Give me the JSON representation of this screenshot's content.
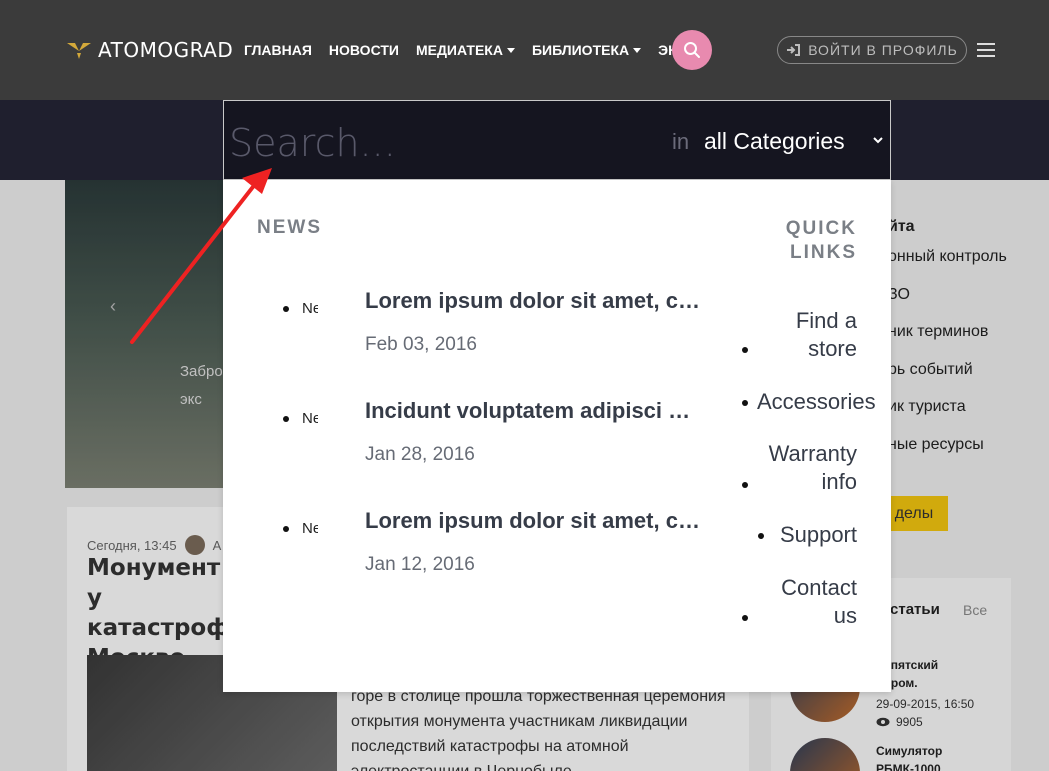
{
  "header": {
    "logo_text": "ATOMOGRAD",
    "nav": [
      {
        "label": "ГЛАВНАЯ",
        "has_caret": false
      },
      {
        "label": "НОВОСТИ",
        "has_caret": false
      },
      {
        "label": "МЕДИАТЕКА",
        "has_caret": true
      },
      {
        "label": "БИБЛИОТЕКА",
        "has_caret": true
      },
      {
        "label": "ЭКСКУР",
        "has_caret": false
      }
    ],
    "login_label": "ВОЙТИ В ПРОФИЛЬ"
  },
  "search": {
    "placeholder": "Search...",
    "in_label": "in",
    "category_selected": "all Categories"
  },
  "dropdown": {
    "news_heading": "NEWS",
    "news": [
      {
        "thumb_label": "Ne",
        "title": "Lorem ipsum dolor sit amet, consectetur",
        "date": "Feb 03, 2016"
      },
      {
        "thumb_label": "Ne",
        "title": "Incidunt voluptatem adipisci quaerat",
        "date": "Jan 28, 2016"
      },
      {
        "thumb_label": "Ne",
        "title": "Lorem ipsum dolor sit amet, consectetur",
        "date": "Jan 12, 2016"
      }
    ],
    "quick_links_heading": "QUICK LINKS",
    "quick_links": [
      "Find a store",
      "Accessories",
      "Warranty info",
      "Support",
      "Contact us"
    ]
  },
  "background": {
    "hero_text": "Забро\nэкс",
    "article_meta": "Сегодня, 13:45",
    "article_author": "А",
    "article_title": "Монумент у\nкатастрофы\nМоскве",
    "article_body": "горе в столице прошла торжественная церемония открытия монумента участникам ликвидации последствий катастрофы на атомной электростанции в Чернобыле",
    "sidebar_title": "йта",
    "sidebar_items": [
      "онный контроль",
      "ЗО",
      "ник терминов",
      "рь событий",
      "ик туриста",
      "ные ресурсы"
    ],
    "yellow_button": "делы",
    "articles_title": "статьи",
    "articles_all": "Все",
    "side_items": [
      {
        "title": "рипятский\nндром.",
        "date": "29-09-2015, 16:50",
        "views": "9905"
      },
      {
        "title": "Симулятор\nРБМК-1000",
        "date": "",
        "views": ""
      }
    ]
  },
  "colors": {
    "header_bg": "#3b3b3b",
    "band_bg": "#1f1f2e",
    "search_accent": "#e88aaf",
    "annotation_arrow": "#ee2222",
    "yellow": "#f1c40f"
  }
}
